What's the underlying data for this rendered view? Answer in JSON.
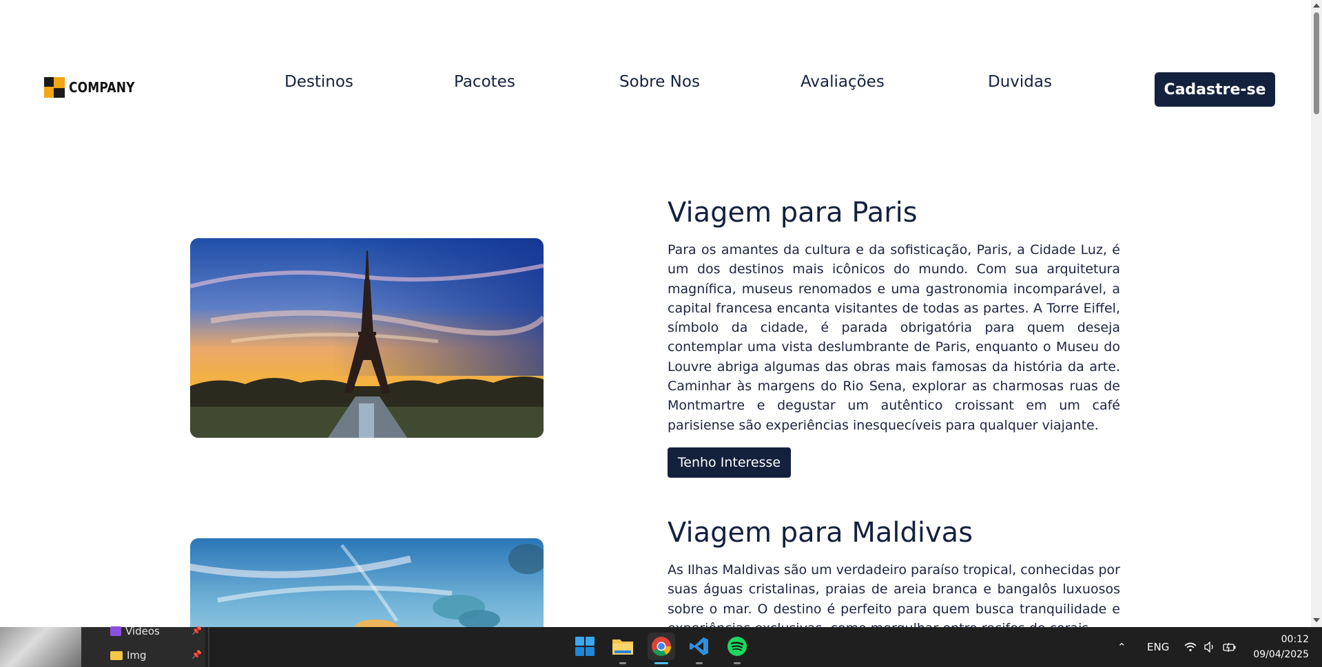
{
  "header": {
    "logo_text": "COMPANY",
    "nav": [
      "Destinos",
      "Pacotes",
      "Sobre Nos",
      "Avaliações",
      "Duvidas"
    ],
    "signup_label": "Cadastre-se"
  },
  "trips": [
    {
      "title": "Viagem para Paris",
      "text": "Para os amantes da cultura e da sofisticação, Paris, a Cidade Luz, é um dos destinos mais icônicos do mundo. Com sua arquitetura magnífica, museus renomados e uma gastronomia incomparável, a capital francesa encanta visitantes de todas as partes. A Torre Eiffel, símbolo da cidade, é parada obrigatória para quem deseja contemplar uma vista deslumbrante de Paris, enquanto o Museu do Louvre abriga algumas das obras mais famosas da história da arte. Caminhar às margens do Rio Sena, explorar as charmosas ruas de Montmartre e degustar um autêntico croissant em um café parisiense são experiências inesquecíveis para qualquer viajante.",
      "button": "Tenho Interesse"
    },
    {
      "title": "Viagem para Maldivas",
      "text": "As Ilhas Maldivas são um verdadeiro paraíso tropical, conhecidas por suas águas cristalinas, praias de areia branca e bangalôs luxuosos sobre o mar. O destino é perfeito para quem busca tranquilidade e experiências exclusivas, como mergulhar entre recifes de corais"
    }
  ],
  "taskbar": {
    "panel_items": [
      "Videos",
      "Img"
    ],
    "apps": [
      "start-icon",
      "file-explorer-icon",
      "chrome-icon",
      "vscode-icon",
      "spotify-icon"
    ],
    "language": "ENG",
    "time": "00:12",
    "date": "09/04/2025"
  },
  "colors": {
    "primary": "#14213d",
    "accent": "#f2a516"
  }
}
